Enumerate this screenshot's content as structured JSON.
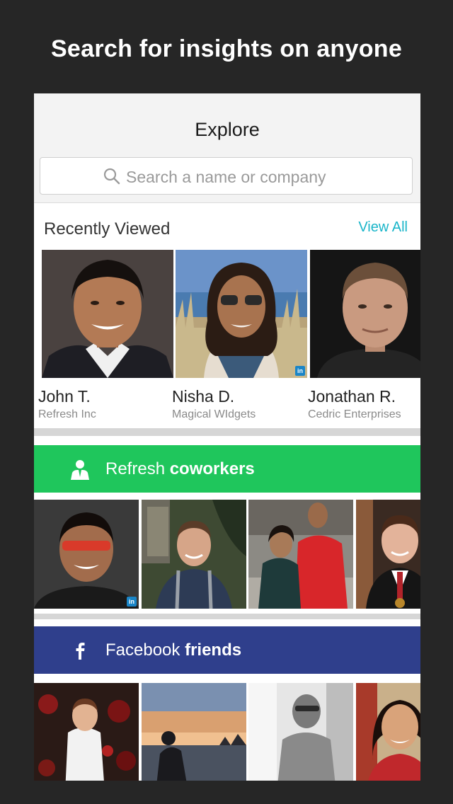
{
  "headline": "Search for insights on anyone",
  "nav": {
    "title": "Explore"
  },
  "search": {
    "placeholder": "Search a name or company"
  },
  "recently_viewed": {
    "title": "Recently Viewed",
    "view_all": "View All",
    "people": [
      {
        "name": "John T.",
        "company": "Refresh Inc"
      },
      {
        "name": "Nisha D.",
        "company": "Magical WIdgets"
      },
      {
        "name": "Jonathan R.",
        "company": "Cedric Enterprises"
      }
    ]
  },
  "coworkers": {
    "prefix": "Refresh ",
    "bold": "coworkers",
    "color": "#1fc65c",
    "icon": "person-icon"
  },
  "facebook": {
    "prefix": "Facebook ",
    "bold": "friends",
    "color": "#2f3f8c",
    "icon": "facebook-icon"
  },
  "badges": {
    "linkedin": "in"
  },
  "colors": {
    "accent": "#19b5c9",
    "background": "#262626"
  }
}
